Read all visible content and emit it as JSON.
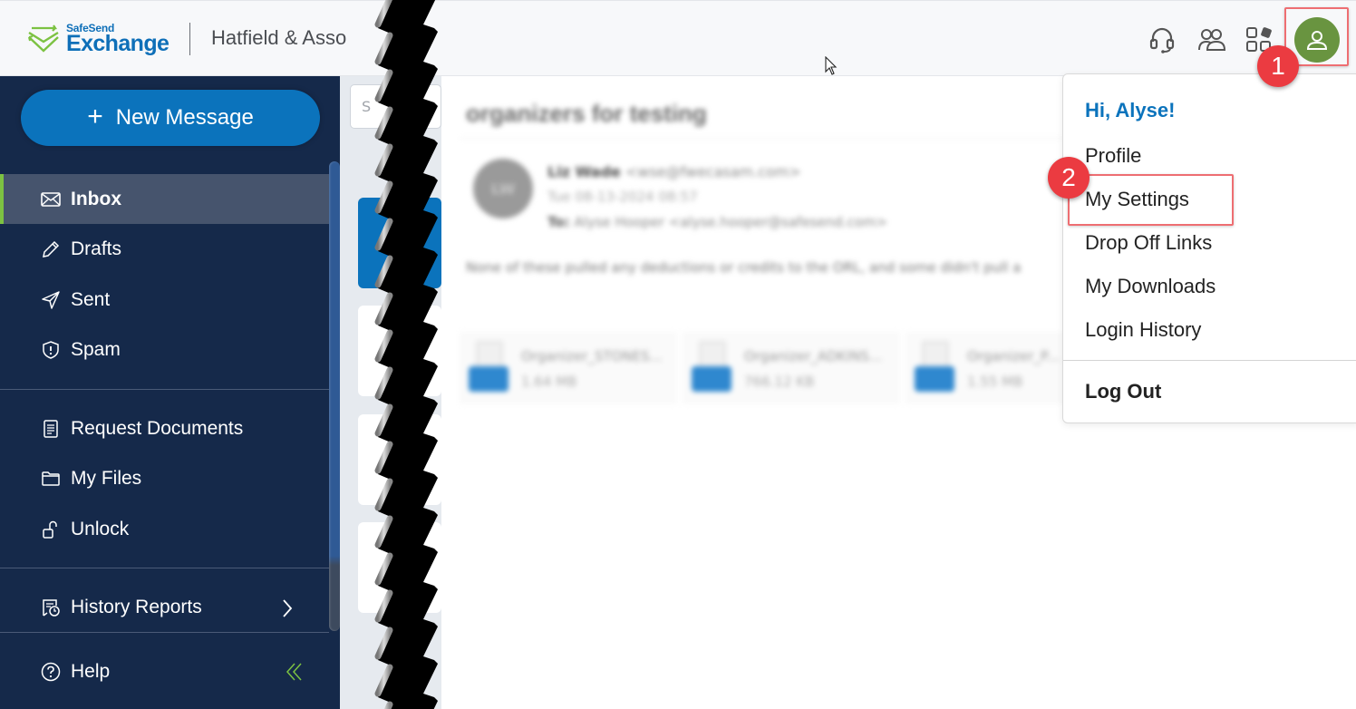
{
  "header": {
    "logo_top": "SafeSend",
    "logo_bottom": "Exchange",
    "company_name": "Hatfield & Asso",
    "icons": [
      "headset-icon",
      "contacts-icon",
      "apps-icon",
      "user-avatar-icon"
    ],
    "avatar_color": "#699440"
  },
  "sidebar": {
    "new_message_label": "New Message",
    "primary_items": [
      {
        "label": "Inbox",
        "icon": "envelope-icon",
        "active": true
      },
      {
        "label": "Drafts",
        "icon": "pencil-icon",
        "active": false
      },
      {
        "label": "Sent",
        "icon": "paper-plane-icon",
        "active": false
      },
      {
        "label": "Spam",
        "icon": "shield-alert-icon",
        "active": false
      }
    ],
    "secondary_items": [
      {
        "label": "Request Documents",
        "icon": "document-icon"
      },
      {
        "label": "My Files",
        "icon": "folder-icon"
      },
      {
        "label": "Unlock",
        "icon": "unlock-icon"
      }
    ],
    "history_reports_label": "History Reports",
    "help_label": "Help",
    "accent_color": "#7cc242",
    "background_color": "#15294a"
  },
  "message_list": {
    "search_placeholder": "S"
  },
  "reading_pane": {
    "subject": "organizers for testing",
    "sender_initials": "LW",
    "sender_name": "Liz Wade",
    "sender_email": "<wse@fwecasam.com>",
    "date": "Tue 08-13-2024 08:57",
    "to_label": "To:",
    "to_value": "Alyse Hooper <alyse.hooper@safesend.com>",
    "body": "None of these pulled any deductions or credits to the ORL, and some didn't pull a",
    "attachments": [
      {
        "name": "Organizer_STONES...",
        "size": "1.64 MB"
      },
      {
        "name": "Organizer_ADKINS...",
        "size": "766.12 KB"
      },
      {
        "name": "Organizer_P...",
        "size": "1.55 MB"
      }
    ]
  },
  "user_menu": {
    "greeting": "Hi, Alyse!",
    "items": [
      "Profile",
      "My Settings",
      "Drop Off Links",
      "My Downloads",
      "Login History"
    ],
    "logout_label": "Log Out"
  },
  "annotations": [
    {
      "number": "1",
      "target": "user-avatar-button"
    },
    {
      "number": "2",
      "target": "menu-item-my-settings"
    }
  ]
}
